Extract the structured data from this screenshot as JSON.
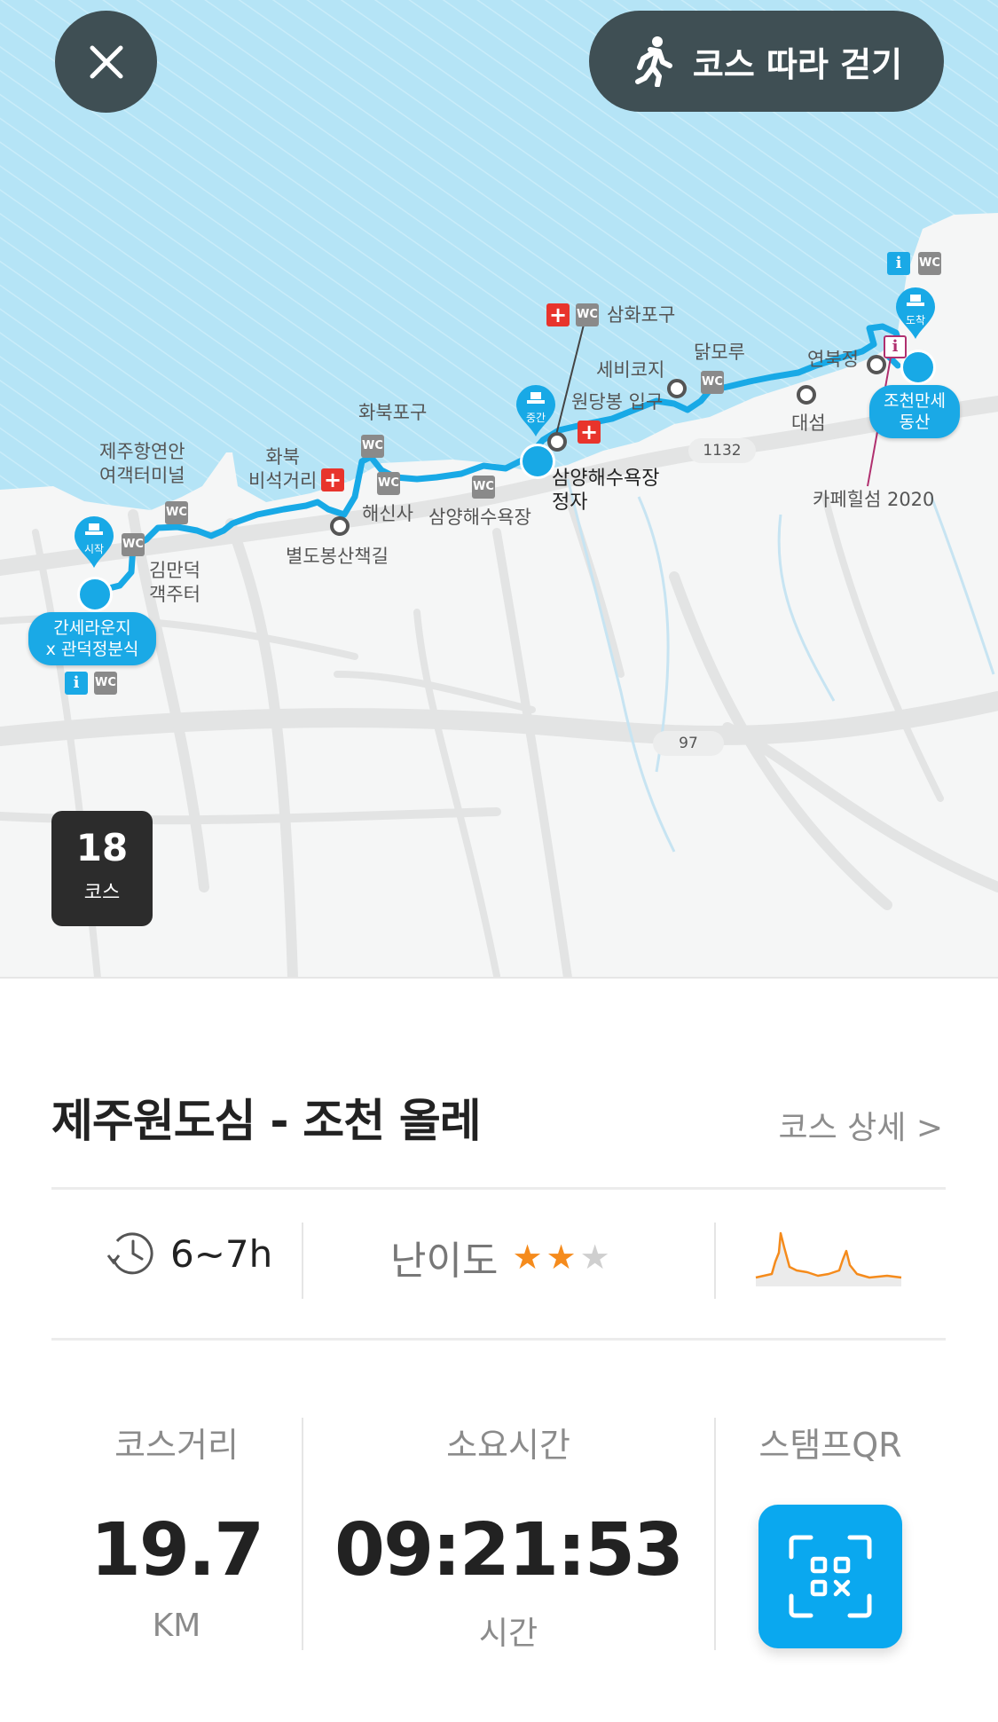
{
  "header": {
    "close_icon": "close-icon",
    "walk_button_label": "코스 따라 걷기",
    "walk_icon": "walker-icon"
  },
  "map": {
    "start_label": "시작",
    "mid_label": "중간",
    "end_label": "도착",
    "start_point": [
      "간세라운지",
      "x 관덕정분식"
    ],
    "end_point": [
      "조천만세",
      "동산"
    ],
    "places": {
      "jeju_terminal": [
        "제주항연안",
        "여객터미널"
      ],
      "kimmanduk": [
        "김만덕",
        "객주터"
      ],
      "hwabuk_bisuk": [
        "화북",
        "비석거리"
      ],
      "hwabuk_port": "화북포구",
      "haesinsa": "해신사",
      "byeoldobong": "별도봉산책길",
      "samyang_beach": "삼양해수욕장",
      "samyang_pavilion": [
        "삼양해수욕장",
        "정자"
      ],
      "samhwa_port": "삼화포구",
      "wondangbong": "원당봉 입구",
      "sebikoji": "세비코지",
      "dakmoru": "닭모루",
      "daeseom": "대섬",
      "yeonbukjeong": "연북정",
      "cafe": "카페힐섬 2020"
    },
    "roads": [
      "1132",
      "97"
    ],
    "facility_icons": [
      "toilet-icon",
      "info-icon",
      "first-aid-icon",
      "cafe-icon"
    ],
    "colors": {
      "sea": "#b3e3f6",
      "land": "#f5f6f6",
      "route": "#18a9e6",
      "road": "#e3e4e4"
    }
  },
  "course_badge": {
    "number": "18",
    "unit": "코스"
  },
  "course": {
    "title": "제주원도심 - 조천 올레",
    "detail_link": "코스 상세 >",
    "duration": "6~7h",
    "difficulty_label": "난이도",
    "difficulty_level": 2,
    "difficulty_max": 3,
    "elevation_icon": "elevation-profile"
  },
  "stats": {
    "distance_label": "코스거리",
    "distance_value": "19.7",
    "distance_unit": "KM",
    "time_label": "소요시간",
    "time_value": "09:21:53",
    "time_unit": "시간",
    "stamp_label": "스탬프QR",
    "stamp_icon": "qr-scan-icon"
  },
  "colors": {
    "accent": "#0aa8ef",
    "star": "#f58b1c",
    "button_dark": "#3f4f54"
  }
}
